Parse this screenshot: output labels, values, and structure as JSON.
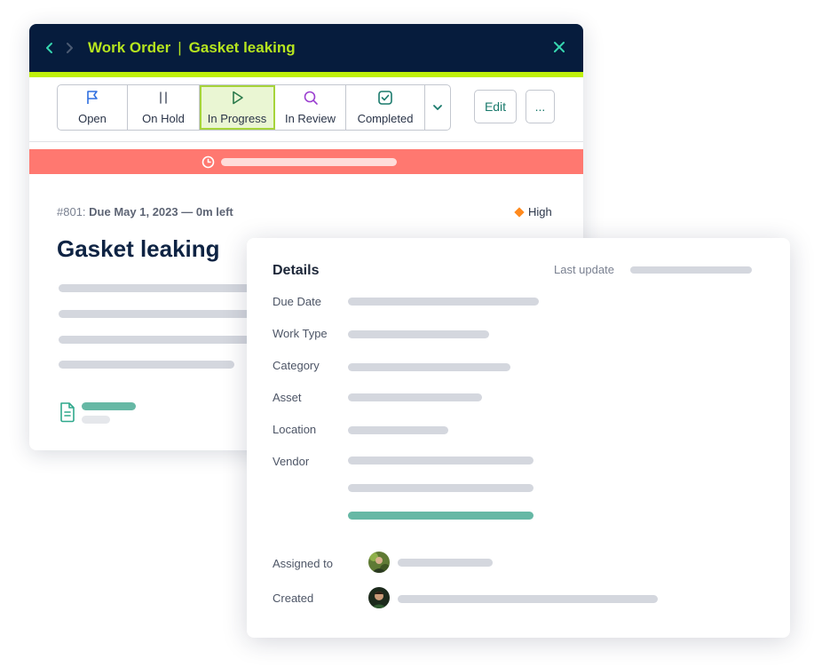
{
  "header": {
    "breadcrumb_root": "Work Order",
    "breadcrumb_separator": "|",
    "breadcrumb_current": "Gasket leaking",
    "back_icon": "chevron-left-icon",
    "forward_icon": "chevron-right-icon",
    "close_icon": "close-icon"
  },
  "toolbar": {
    "statuses": [
      {
        "label": "Open",
        "icon": "flag-icon"
      },
      {
        "label": "On Hold",
        "icon": "pause-icon"
      },
      {
        "label": "In Progress",
        "icon": "play-icon",
        "active": true
      },
      {
        "label": "In Review",
        "icon": "search-icon"
      },
      {
        "label": "Completed",
        "icon": "check-square-icon"
      }
    ],
    "dropdown_icon": "chevron-down-icon",
    "edit_label": "Edit",
    "more_label": "..."
  },
  "work_order": {
    "number": "#801:",
    "due": "Due May 1, 2023 — 0m left",
    "priority": "High",
    "title": "Gasket leaking"
  },
  "details": {
    "title": "Details",
    "last_update_label": "Last update",
    "fields": [
      {
        "label": "Due Date"
      },
      {
        "label": "Work Type"
      },
      {
        "label": "Category"
      },
      {
        "label": "Asset"
      },
      {
        "label": "Location"
      },
      {
        "label": "Vendor"
      }
    ],
    "assigned_to_label": "Assigned to",
    "created_label": "Created"
  },
  "colors": {
    "header_bg": "#061c3d",
    "accent": "#bff00a",
    "breadcrumb": "#b6e51f",
    "timer_bar": "#ff7870",
    "teal": "#1a7a6c",
    "priority_high": "#ff8a1e"
  }
}
